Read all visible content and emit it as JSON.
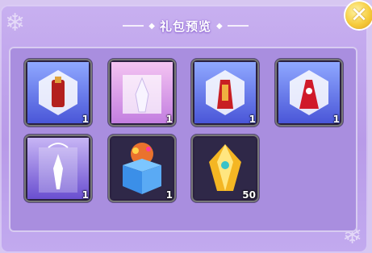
{
  "dialog": {
    "title": "礼包预览",
    "close_icon_glyph": "✕"
  },
  "items": [
    {
      "name": "red-outfit-bag",
      "icon": "gift-bag-icon",
      "count": "1"
    },
    {
      "name": "white-dress-bag",
      "icon": "gift-bag-icon",
      "count": "1"
    },
    {
      "name": "red-gold-outfit-bag",
      "icon": "gift-bag-icon",
      "count": "1"
    },
    {
      "name": "red-dress-bag",
      "icon": "gift-bag-icon",
      "count": "1"
    },
    {
      "name": "white-gown-bag",
      "icon": "gift-bag-icon",
      "count": "1"
    },
    {
      "name": "gift-box",
      "icon": "gift-box-icon",
      "count": "1"
    },
    {
      "name": "gold-gem",
      "icon": "gem-icon",
      "count": "50"
    }
  ],
  "colors": {
    "accent": "#f6cc3d",
    "panel": "#a98edf",
    "slot": "#2a2040"
  }
}
